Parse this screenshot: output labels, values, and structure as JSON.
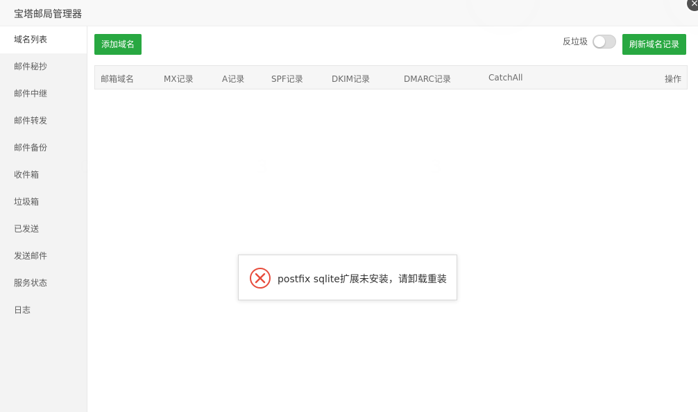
{
  "window": {
    "title": "宝塔邮局管理器",
    "close_label": "×"
  },
  "sidebar": {
    "items": [
      {
        "label": "域名列表",
        "active": true
      },
      {
        "label": "邮件秘抄"
      },
      {
        "label": "邮件中继"
      },
      {
        "label": "邮件转发"
      },
      {
        "label": "邮件备份"
      },
      {
        "label": "收件箱"
      },
      {
        "label": "垃圾箱"
      },
      {
        "label": "已发送"
      },
      {
        "label": "发送邮件"
      },
      {
        "label": "服务状态"
      },
      {
        "label": "日志"
      }
    ]
  },
  "toolbar": {
    "add_domain": "添加域名",
    "anti_spam_label": "反垃圾",
    "anti_spam_on": false,
    "refresh_records": "刷新域名记录"
  },
  "table": {
    "columns": [
      "邮箱域名",
      "MX记录",
      "A记录",
      "SPF记录",
      "DKIM记录",
      "DMARC记录",
      "CatchAll",
      "操作"
    ]
  },
  "toast": {
    "message": "postfix sqlite扩展未安装，请卸载重装",
    "icon": "error-x-icon"
  },
  "colors": {
    "brand_green": "#20a53a",
    "error_red": "#e74c3c"
  }
}
